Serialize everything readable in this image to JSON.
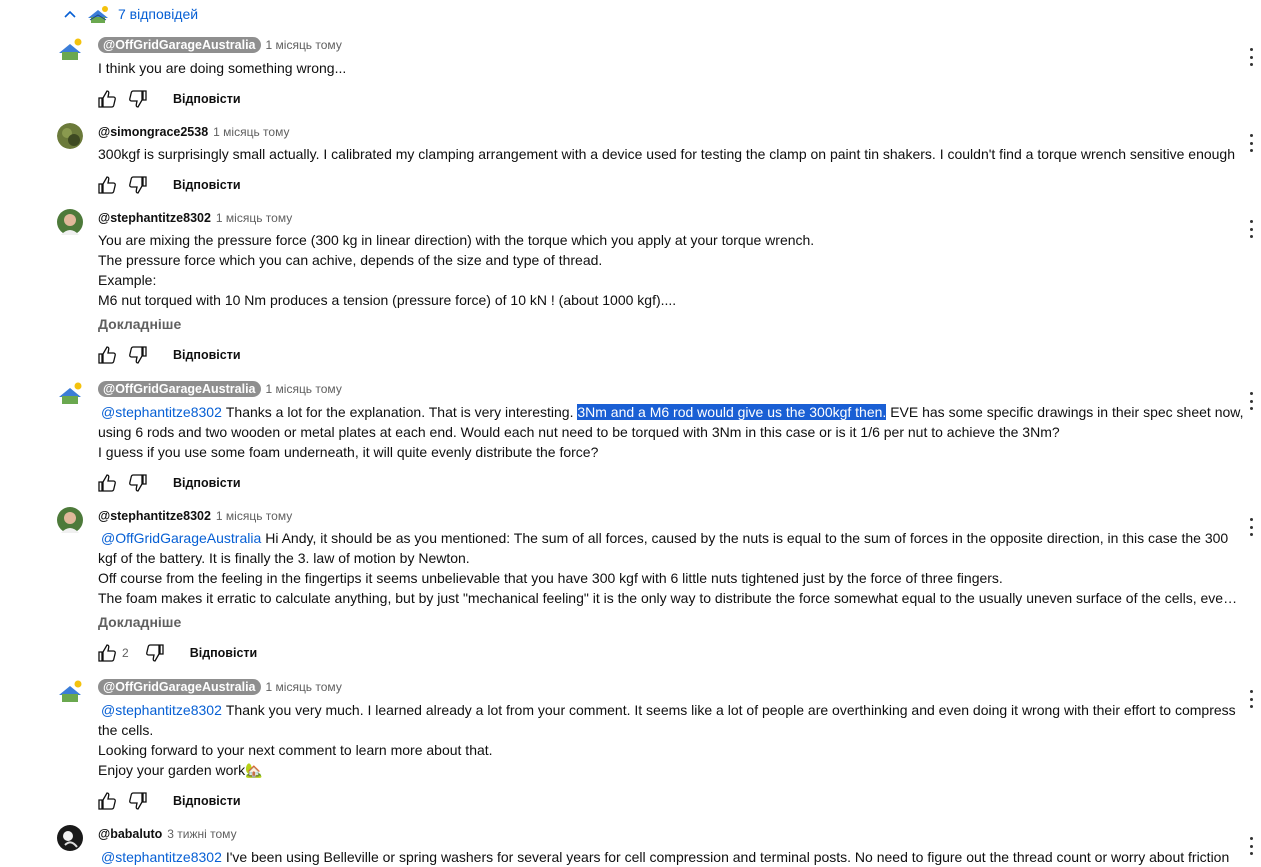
{
  "replies_toggle": {
    "count_label": "7 відповідей"
  },
  "labels": {
    "reply": "Відповісти",
    "read_more": "Докладніше"
  },
  "colors": {
    "link": "#065fd4",
    "highlight": "#1a5fd4",
    "author_pill": "#8f8f8f"
  },
  "comments": [
    {
      "author": "@OffGridGarageAustralia",
      "time": "1 місяць тому",
      "pill": true,
      "lines": [
        "I think you are doing something wrong..."
      ]
    },
    {
      "author": "@simongrace2538",
      "time": "1 місяць тому",
      "lines": [
        "300kgf is surprisingly small actually. I calibrated my clamping arrangement with a device used for testing the clamp on paint tin shakers. I couldn't find a torque wrench sensitive enough"
      ]
    },
    {
      "author": "@stephantitze8302",
      "time": "1 місяць тому",
      "lines": [
        "You are mixing the pressure force (300 kg in linear direction) with the torque which you apply at your torque wrench.",
        "The pressure force which you can achive, depends of the size and type of thread.",
        "Example:",
        "M6 nut torqued with 10 Nm produces a tension (pressure force) of 10 kN ! (about 1000 kgf)...."
      ]
    },
    {
      "author": "@OffGridGarageAustralia",
      "time": "1 місяць тому",
      "pill": true,
      "mention": "@stephantitze8302",
      "line1_before": "Thanks a lot for the explanation. That is very interesting. ",
      "line1_highlight": "3Nm and a M6 rod would give us the 300kgf then.",
      "line1_after": " EVE has some specific drawings in their spec sheet now,",
      "lines": [
        "using 6 rods and two wooden or metal plates at each end. Would each nut need to be torqued with 3Nm in this case or is it 1/6 per nut to achieve the 3Nm?",
        "I guess if you use some foam underneath, it will quite evenly distribute the force?"
      ]
    },
    {
      "author": "@stephantitze8302",
      "time": "1 місяць тому",
      "mention": "@OffGridGarageAustralia",
      "line1": "Hi Andy, it should be as you mentioned: The sum of all forces, caused by the nuts is equal to the sum of forces in the opposite direction, in this case the 300",
      "lines": [
        "kgf of the battery. It is finally the 3. law of motion by Newton.",
        "Off course from the feeling in the fingertips it seems unbelievable that you have 300 kgf with 6 little nuts tightened just by the force of three fingers.",
        "The foam makes it erratic to calculate anything, but by just \"mechanical feeling\" it is the only way to distribute the force  somewhat equal to the usually uneven surface of the cells, eve…"
      ],
      "likes": "2"
    },
    {
      "author": "@OffGridGarageAustralia",
      "time": "1 місяць тому",
      "pill": true,
      "mention": "@stephantitze8302",
      "line1": "Thank you very much. I learned already a lot from your comment. It seems like a lot of people are overthinking and even doing it wrong with their effort to compress",
      "lines": [
        "the cells.",
        "Looking forward to your next comment to learn more about that.",
        "Enjoy your garden work"
      ],
      "emoji": "🏡"
    },
    {
      "author": "@babaluto",
      "time": "3 тижні тому",
      "mention": "@stephantitze8302",
      "line1": "I've been using Belleville or spring washers for several years for cell compression and terminal posts. No need to figure out the thread count or worry about friction"
    }
  ]
}
